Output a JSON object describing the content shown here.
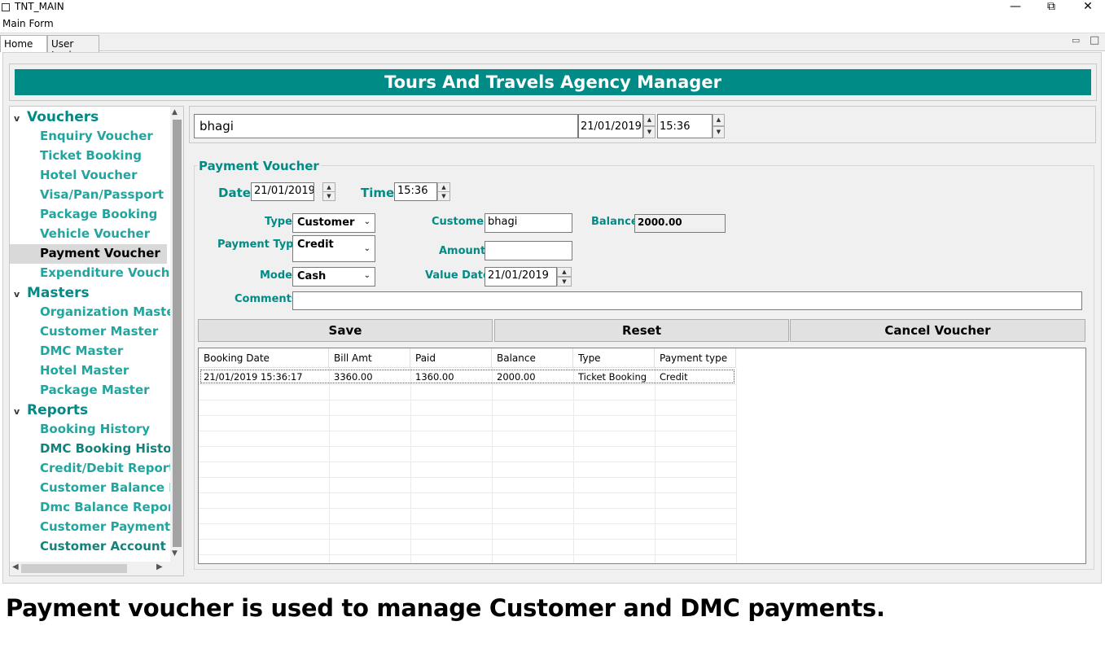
{
  "window": {
    "title": "TNT_MAIN",
    "minimize": "—",
    "restore": "⧉",
    "close": "✕"
  },
  "menu": {
    "main_form": "Main Form"
  },
  "tabs": [
    {
      "label": "Home",
      "close": "⊠"
    },
    {
      "label": "User Login"
    }
  ],
  "tab_controls": {
    "minimize": "▭",
    "maximize": "□"
  },
  "banner": {
    "title": "Tours And Travels Agency Manager"
  },
  "nav": {
    "vouchers": {
      "label": "Vouchers",
      "items": [
        "Enquiry Voucher",
        "Ticket Booking",
        "Hotel Voucher",
        "Visa/Pan/Passport",
        "Package Booking",
        "Vehicle Voucher",
        "Payment Voucher",
        "Expenditure Voucher"
      ]
    },
    "masters": {
      "label": "Masters",
      "items": [
        "Organization Master",
        "Customer Master",
        "DMC Master",
        "Hotel Master",
        "Package Master"
      ]
    },
    "reports": {
      "label": "Reports",
      "items": [
        "Booking History",
        "DMC Booking History",
        "Credit/Debit Report",
        "Customer Balance Report",
        "Dmc Balance Report",
        "Customer Payment Report",
        "Customer Account Report"
      ]
    },
    "selected": "Payment Voucher"
  },
  "userbar": {
    "user": "bhagi",
    "date": "21/01/2019",
    "time": "15:36"
  },
  "voucher": {
    "legend": "Payment Voucher",
    "date_label": "Date",
    "date_value": "21/01/2019",
    "time_label": "Time",
    "time_value": "15:36",
    "type_label": "Type",
    "type_value": "Customer",
    "payment_type_label": "Payment Type",
    "payment_type_value": "Credit",
    "mode_label": "Mode",
    "mode_value": "Cash",
    "customer_label": "Customer",
    "customer_value": "bhagi",
    "amount_label": "Amount",
    "amount_value": "",
    "value_date_label": "Value Date",
    "value_date_value": "21/01/2019",
    "balance_label": "Balance",
    "balance_value": "2000.00",
    "comments_label": "Comments",
    "comments_value": ""
  },
  "buttons": {
    "save": "Save",
    "reset": "Reset",
    "cancel": "Cancel Voucher"
  },
  "grid": {
    "headers": [
      "Booking Date",
      "Bill Amt",
      "Paid",
      "Balance",
      "Type",
      "Payment type"
    ],
    "rows": [
      [
        "21/01/2019 15:36:17",
        "3360.00",
        "1360.00",
        "2000.00",
        "Ticket Booking",
        "Credit"
      ]
    ]
  },
  "caption": "Payment voucher is used to manage Customer and DMC payments."
}
